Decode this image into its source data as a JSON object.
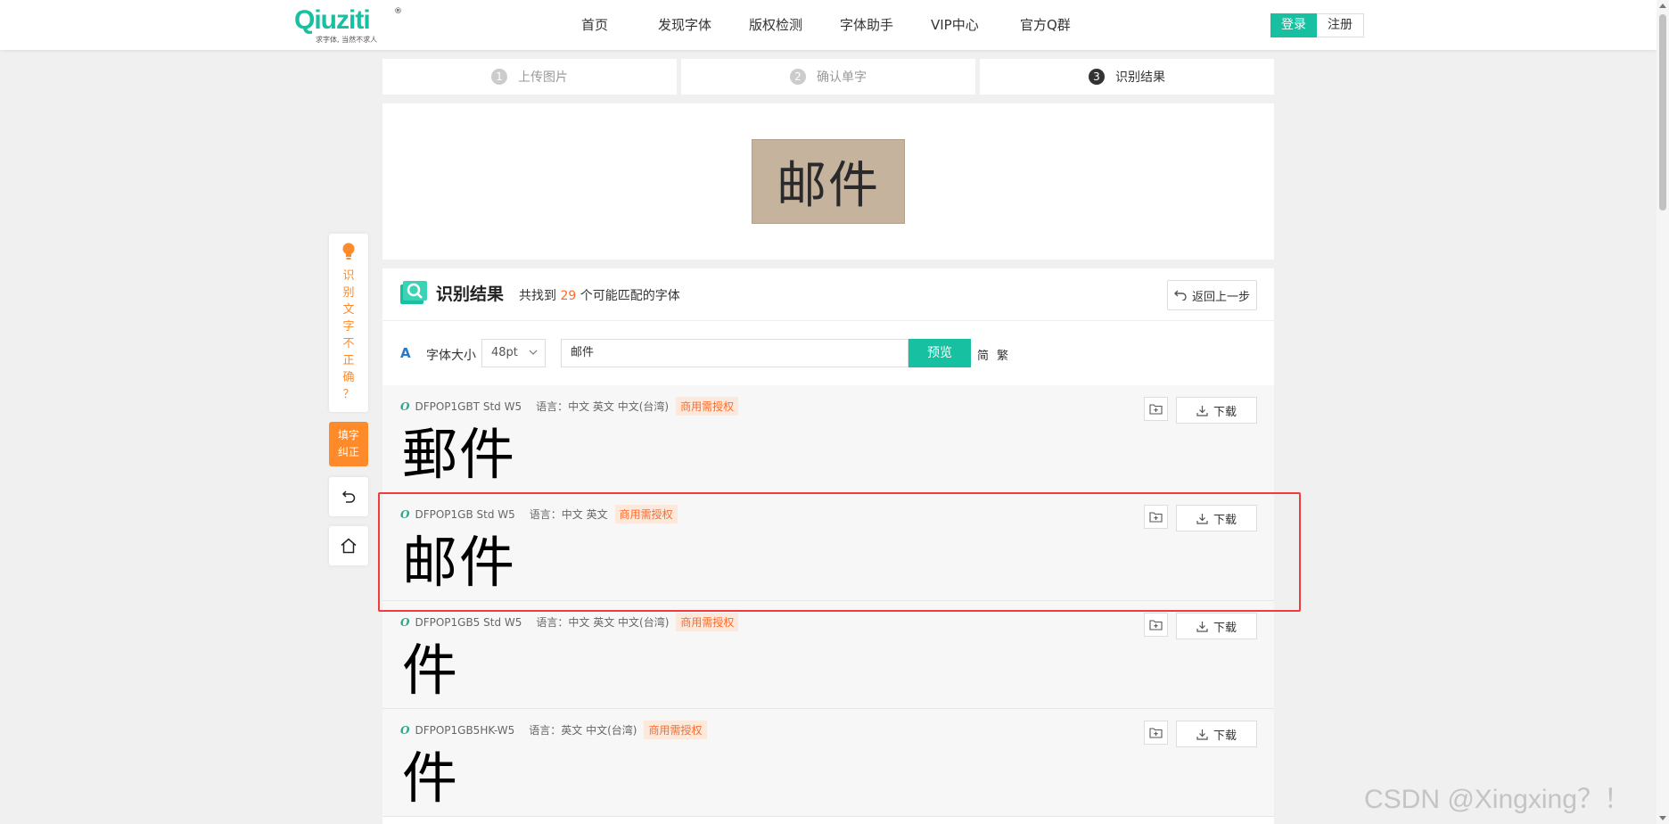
{
  "brand": {
    "logo_text": "Qiuziti",
    "tagline": "求字体, 当然不求人",
    "registered_mark": "®"
  },
  "nav": {
    "items": [
      "首页",
      "发现字体",
      "版权检测",
      "字体助手",
      "VIP中心",
      "官方Q群"
    ],
    "login": "登录",
    "register": "注册"
  },
  "steps": [
    {
      "num": "1",
      "label": "上传图片"
    },
    {
      "num": "2",
      "label": "确认单字"
    },
    {
      "num": "3",
      "label": "识别结果"
    }
  ],
  "uploaded_image": {
    "text": "邮件"
  },
  "results": {
    "title": "识别结果",
    "count_prefix": "共找到",
    "count": "29",
    "count_suffix": "个可能匹配的字体",
    "back_label": "返回上一步"
  },
  "toolbar": {
    "icon_text": "A",
    "size_label": "字体大小",
    "size_value": "48pt",
    "input_value": "邮件",
    "preview_label": "预览",
    "simplified": "简",
    "traditional": "繁"
  },
  "fonts": [
    {
      "name": "DFPOP1GBT Std W5",
      "lang": "语言：中文 英文 中文(台湾)",
      "badge": "商用需授权",
      "sample": "郵件",
      "download": "下载"
    },
    {
      "name": "DFPOP1GB Std W5",
      "lang": "语言：中文 英文",
      "badge": "商用需授权",
      "sample": "邮件",
      "download": "下载"
    },
    {
      "name": "DFPOP1GB5 Std W5",
      "lang": "语言：中文 英文 中文(台湾)",
      "badge": "商用需授权",
      "sample": "件",
      "download": "下载"
    },
    {
      "name": "DFPOP1GB5HK-W5",
      "lang": "语言：英文 中文(台湾)",
      "badge": "商用需授权",
      "sample": "件",
      "download": "下载"
    }
  ],
  "side": {
    "tip_text": "识别文字不正确？",
    "fill_line1": "填字",
    "fill_line2": "纠正"
  },
  "watermark": "CSDN @Xingxing？！",
  "colors": {
    "accent": "#17c0a0",
    "orange": "#ff8a2a",
    "highlight": "#f03c3c"
  }
}
